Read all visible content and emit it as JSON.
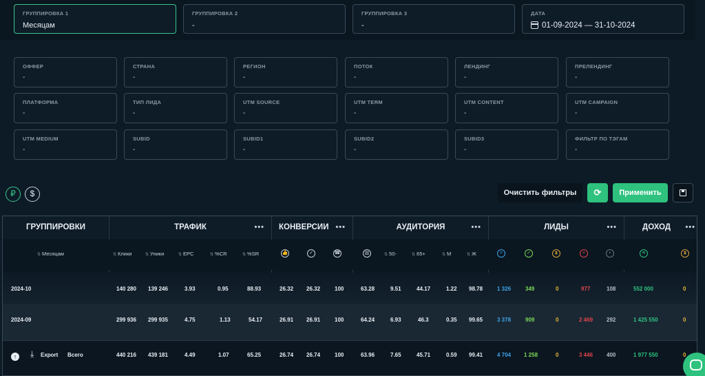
{
  "grouping": [
    {
      "label": "ГРУППИРОВКА 1",
      "value": "Месяцам"
    },
    {
      "label": "ГРУППИРОВКА 2",
      "value": "-"
    },
    {
      "label": "ГРУППИРОВКА 3",
      "value": "-"
    }
  ],
  "date": {
    "label": "ДАТА",
    "value": "01-09-2024 — 31-10-2024"
  },
  "filters": [
    {
      "label": "ОФФЕР",
      "value": "-"
    },
    {
      "label": "СТРАНА",
      "value": "-"
    },
    {
      "label": "РЕГИОН",
      "value": "-"
    },
    {
      "label": "ПОТОК",
      "value": "-"
    },
    {
      "label": "ЛЕНДИНГ",
      "value": "-"
    },
    {
      "label": "ПРЕЛЕНДИНГ",
      "value": "-"
    },
    {
      "label": "ПЛАТФОРМА",
      "value": "-"
    },
    {
      "label": "ТИП ЛИДА",
      "value": "-"
    },
    {
      "label": "UTM SOURCE",
      "value": "-"
    },
    {
      "label": "UTM TERM",
      "value": "-"
    },
    {
      "label": "UTM CONTENT",
      "value": "-"
    },
    {
      "label": "UTM CAMPAIGN",
      "value": "-"
    },
    {
      "label": "UTM MEDIUM",
      "value": "-"
    },
    {
      "label": "SUBID",
      "value": "-"
    },
    {
      "label": "SUBID1",
      "value": "-"
    },
    {
      "label": "SUBID2",
      "value": "-"
    },
    {
      "label": "SUBID3",
      "value": "-"
    },
    {
      "label": "ФИЛЬТР ПО ТЭГАМ",
      "value": "-"
    }
  ],
  "currency": {
    "rub": "₽",
    "usd": "$"
  },
  "buttons": {
    "clear": "Очистить фильтры",
    "apply": "Применить",
    "refresh": "⟳"
  },
  "table": {
    "groups": {
      "grouping": "ГРУППИРОВКИ",
      "traffic": "ТРАФИК",
      "conversions": "КОНВЕРСИИ",
      "audience": "АУДИТОРИЯ",
      "leads": "ЛИДЫ",
      "income": "ДОХОД",
      "more": "•••"
    },
    "sub": {
      "months": "Месяцам",
      "clicks": "Клики",
      "uniques": "Уники",
      "epc": "EPC",
      "cr": "%CR",
      "sr": "%SR",
      "age50": "50-",
      "age65": "65+",
      "male": "М",
      "female": "Ж"
    },
    "rows": [
      {
        "period": "2024-10",
        "clicks": "140 280",
        "uniques": "139 246",
        "epc": "3.93",
        "cr": "0.95",
        "sr": "88.93",
        "conv1": "26.32",
        "conv2": "26.32",
        "conv3": "100",
        "aud1": "63.28",
        "aud50": "9.51",
        "aud65": "44.17",
        "male": "1.22",
        "female": "98.78",
        "leads_total": "1 326",
        "leads_approved": "349",
        "leads_hold": "0",
        "leads_rejected": "977",
        "leads_trash": "108",
        "income_approved": "552 000",
        "income_hold": "0"
      },
      {
        "period": "2024-09",
        "clicks": "299 936",
        "uniques": "299 935",
        "epc": "4.75",
        "cr": "1.13",
        "sr": "54.17",
        "conv1": "26.91",
        "conv2": "26.91",
        "conv3": "100",
        "aud1": "64.24",
        "aud50": "6.93",
        "aud65": "46.3",
        "male": "0.35",
        "female": "99.65",
        "leads_total": "3 378",
        "leads_approved": "909",
        "leads_hold": "0",
        "leads_rejected": "2 469",
        "leads_trash": "292",
        "income_approved": "1 425 550",
        "income_hold": "0"
      }
    ],
    "total": {
      "export": "Export",
      "label": "Всего",
      "clicks": "440 216",
      "uniques": "439 181",
      "epc": "4.49",
      "cr": "1.07",
      "sr": "65.25",
      "conv1": "26.74",
      "conv2": "26.74",
      "conv3": "100",
      "aud1": "63.96",
      "aud50": "7.65",
      "aud65": "45.71",
      "male": "0.59",
      "female": "99.41",
      "leads_total": "4 704",
      "leads_approved": "1 258",
      "leads_hold": "0",
      "leads_rejected": "3 446",
      "leads_trash": "400",
      "income_approved": "1 977 550",
      "income_hold": "0"
    }
  },
  "colors": {
    "accent": "#2ec27e",
    "leads_total": "#3ea3e8",
    "approved": "#7ed957",
    "hold": "#e6b53a",
    "rejected": "#e0454b"
  }
}
